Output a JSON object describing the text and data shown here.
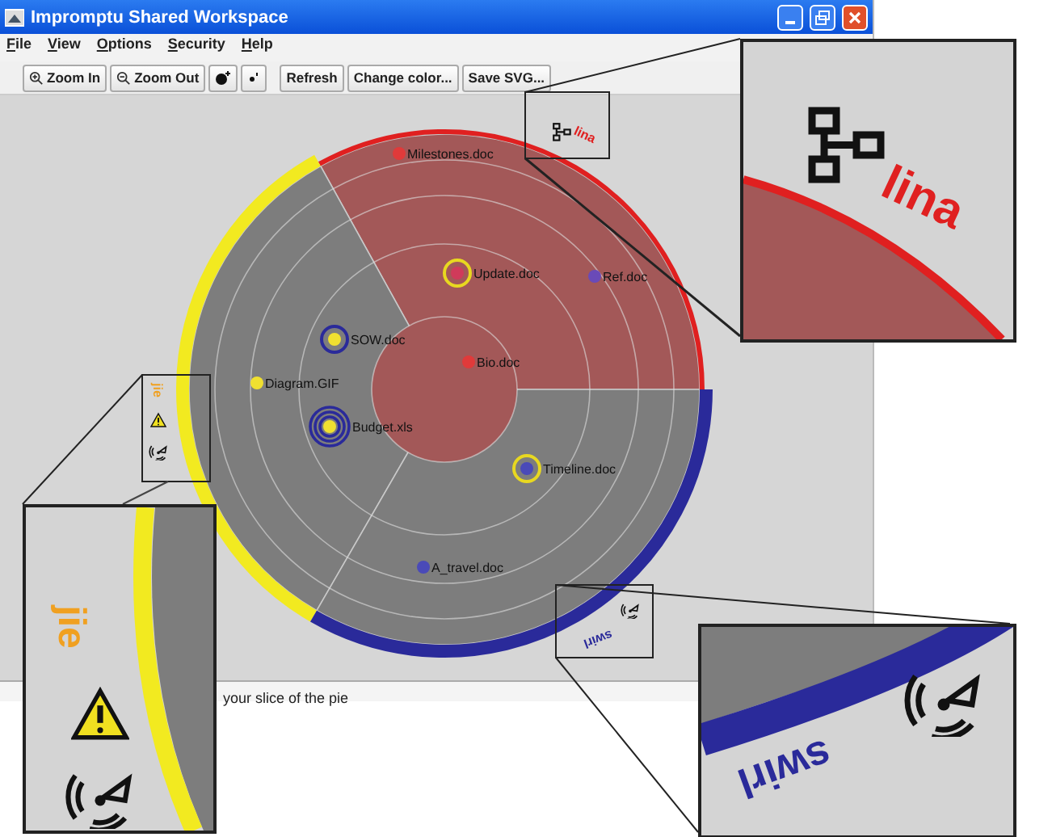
{
  "window": {
    "title": "Impromptu Shared Workspace"
  },
  "menu": [
    "File",
    "View",
    "Options",
    "Security",
    "Help"
  ],
  "toolbar": [
    {
      "label": "Zoom In",
      "kind": "zoom-in"
    },
    {
      "label": "Zoom Out",
      "kind": "zoom-out"
    },
    {
      "kind": "large-dot"
    },
    {
      "kind": "small-dot"
    },
    {
      "label": "Refresh",
      "kind": "text"
    },
    {
      "label": "Change color...",
      "kind": "text"
    },
    {
      "label": "Save SVG...",
      "kind": "text"
    }
  ],
  "users": [
    {
      "name": "lina",
      "color": "#e02020",
      "band": {
        "color": "#e02020"
      },
      "selected": true,
      "badges": [
        {
          "kind": "network"
        }
      ]
    },
    {
      "name": "jie",
      "color": "#f0a020",
      "band": {
        "color": "#f2ea20"
      },
      "selected": false,
      "badges": [
        {
          "kind": "warning"
        },
        {
          "kind": "wifi"
        }
      ]
    },
    {
      "name": "swirl",
      "color": "#2a2a9a",
      "band": {
        "color": "#2a2a9a"
      },
      "selected": false,
      "badges": [
        {
          "kind": "wifi"
        }
      ]
    }
  ],
  "files": [
    {
      "name": "Milestones.doc",
      "color": "#e03a3a"
    },
    {
      "name": "Update.doc",
      "color": "#d03a5a",
      "ring": {
        "color": "#e8d820",
        "kind": "single"
      }
    },
    {
      "name": "Ref.doc",
      "color": "#6a4ab8"
    },
    {
      "name": "SOW.doc",
      "color": "#f0e030",
      "ring": {
        "color": "#2a2a9a",
        "kind": "single"
      }
    },
    {
      "name": "Bio.doc",
      "color": "#e03a3a"
    },
    {
      "name": "Diagram.GIF",
      "color": "#f0e030"
    },
    {
      "name": "Budget.xls",
      "color": "#f0e030",
      "ring": {
        "color": "#2a2a9a",
        "kind": "triple"
      }
    },
    {
      "name": "Timeline.doc",
      "color": "#4a4ab8",
      "ring": {
        "color": "#e8d820",
        "kind": "single"
      }
    },
    {
      "name": "A_travel.doc",
      "color": "#4a4ab8"
    }
  ],
  "callouts": [
    {
      "name": "lina",
      "color": "#e02020",
      "badges": [
        {
          "kind": "network"
        }
      ]
    },
    {
      "name": "jie",
      "color": "#f0a020",
      "badges": [
        {
          "kind": "warning"
        },
        {
          "kind": "wifi"
        }
      ]
    },
    {
      "name": "swirl",
      "color": "#2a2a9a",
      "badges": [
        {
          "kind": "wifi"
        }
      ]
    }
  ],
  "status_bar": "your slice of the pie"
}
